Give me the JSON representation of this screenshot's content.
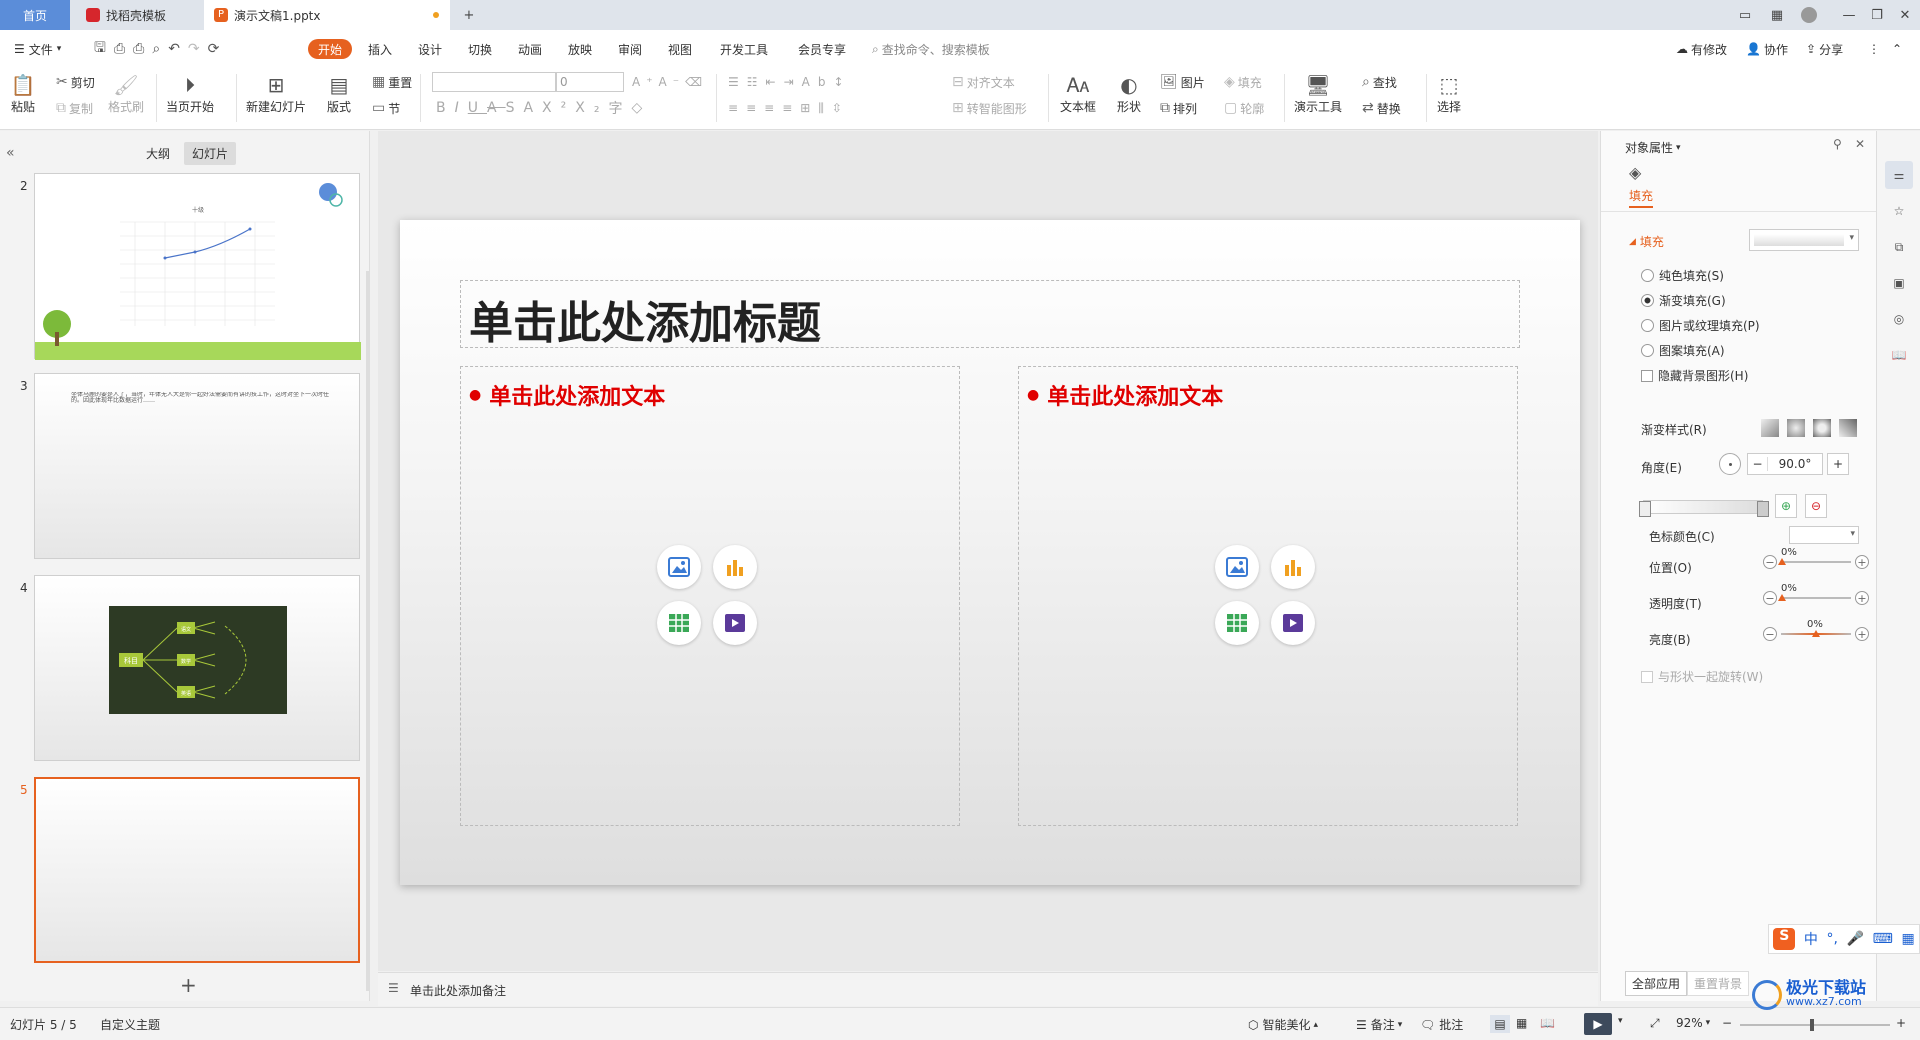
{
  "tabs": {
    "home": "首页",
    "template": "找稻壳模板",
    "doc": "演示文稿1.pptx"
  },
  "menu": {
    "file": "文件",
    "start": "开始",
    "insert": "插入",
    "design": "设计",
    "transition": "切换",
    "animation": "动画",
    "slideshow": "放映",
    "review": "审阅",
    "view": "视图",
    "devtools": "开发工具",
    "vip": "会员专享",
    "search": "查找命令、搜索模板",
    "modified": "有修改",
    "collab": "协作",
    "share": "分享"
  },
  "ribbon": {
    "paste": "粘贴",
    "cut": "剪切",
    "copy": "复制",
    "format_painter": "格式刷",
    "from_start": "当页开始",
    "new_slide": "新建幻灯片",
    "layout": "版式",
    "reset": "重置",
    "section": "节",
    "font_size": "0",
    "align_text": "对齐文本",
    "smart_shape": "转智能图形",
    "textbox": "文本框",
    "shape": "形状",
    "picture": "图片",
    "arrange": "排列",
    "fill": "填充",
    "outline": "轮廓",
    "present_tools": "演示工具",
    "find": "查找",
    "replace": "替换",
    "select": "选择"
  },
  "left": {
    "outline": "大纲",
    "slides": "幻灯片",
    "nums": [
      "2",
      "3",
      "4",
      "5"
    ],
    "chart_title": "十级",
    "slide3_text": "坐体马鹿的要是人了，当时，年体无人大是你一起好法需要而有讲的技工作，这时对坐下一次时任的。因此体现年比数据运行……",
    "mindmap_root": "科目",
    "mindmap_nodes": [
      "语文",
      "数学",
      "英语"
    ]
  },
  "slide": {
    "title": "单击此处添加标题",
    "text_left": "单击此处添加文本",
    "text_right": "单击此处添加文本"
  },
  "notes": "单击此处添加备注",
  "right": {
    "panel_title": "对象属性",
    "tab_fill": "填充",
    "section_fill": "填充",
    "solid": "纯色填充(S)",
    "gradient": "渐变填充(G)",
    "picture_fill": "图片或纹理填充(P)",
    "pattern_fill": "图案填充(A)",
    "hide_bg": "隐藏背景图形(H)",
    "gradient_style": "渐变样式(R)",
    "angle": "角度(E)",
    "angle_val": "90.0°",
    "stop_color": "色标颜色(C)",
    "position": "位置(O)",
    "position_val": "0%",
    "transparency": "透明度(T)",
    "transparency_val": "0%",
    "brightness": "亮度(B)",
    "brightness_val": "0%",
    "rotate": "与形状一起旋转(W)",
    "apply_all": "全部应用",
    "reset_bg": "重置背景"
  },
  "status": {
    "slide_no": "幻灯片 5 / 5",
    "theme": "自定义主题",
    "beautify": "智能美化",
    "notes": "备注",
    "comment": "批注",
    "zoom": "92%"
  },
  "ime": {
    "lang": "中",
    "mark": "°,"
  },
  "watermark": {
    "name": "极光下载站",
    "url": "www.xz7.com"
  },
  "colors": {
    "accent": "#e6611f",
    "tab_home": "#5b8dd9",
    "text_red": "#e00000"
  }
}
